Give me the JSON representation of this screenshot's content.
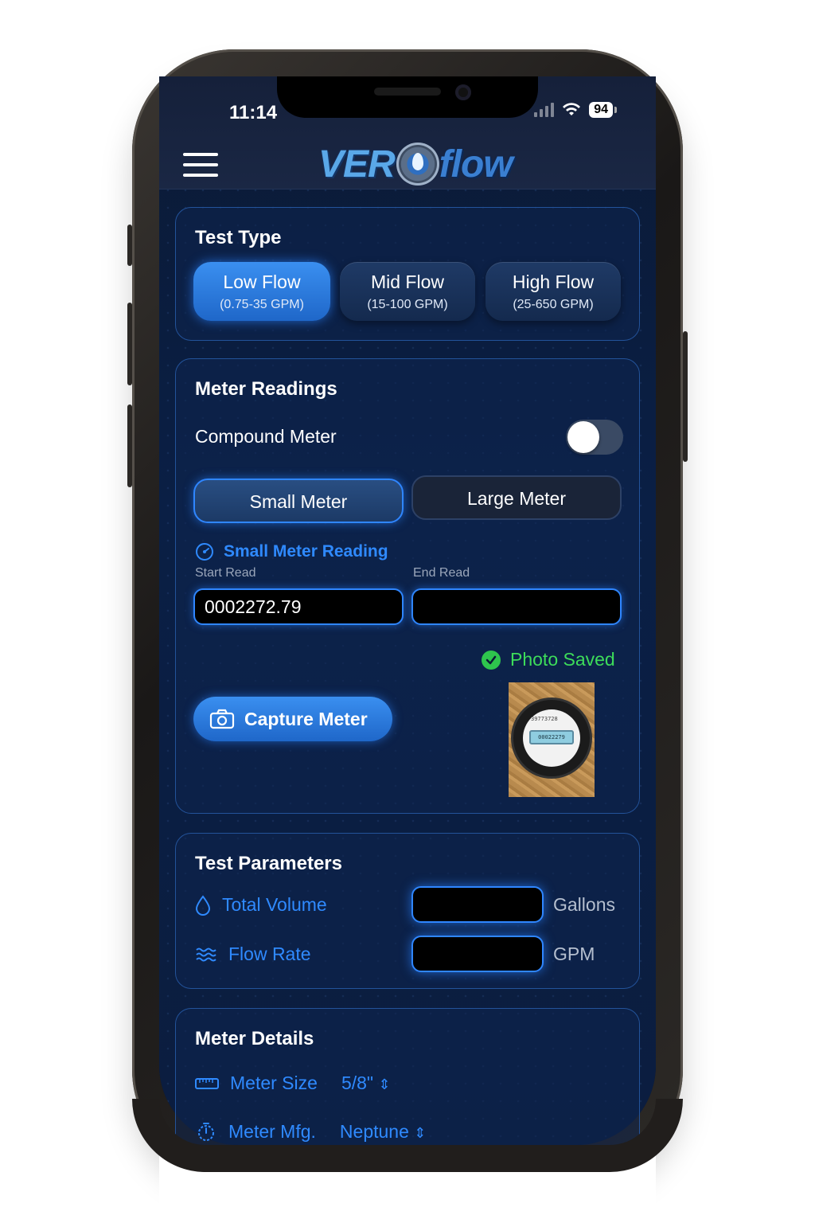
{
  "status_bar": {
    "time": "11:14",
    "battery": "94"
  },
  "header": {
    "logo_left": "VER",
    "logo_right": "flow"
  },
  "test_type": {
    "title": "Test Type",
    "options": [
      {
        "label": "Low Flow",
        "range": "(0.75-35 GPM)",
        "active": true
      },
      {
        "label": "Mid Flow",
        "range": "(15-100 GPM)",
        "active": false
      },
      {
        "label": "High Flow",
        "range": "(25-650 GPM)",
        "active": false
      }
    ]
  },
  "meter_readings": {
    "title": "Meter Readings",
    "compound_label": "Compound Meter",
    "compound_on": false,
    "small_meter_label": "Small Meter",
    "large_meter_label": "Large Meter",
    "reading_title": "Small Meter Reading",
    "start_label": "Start Read",
    "end_label": "End Read",
    "start_value": "0002272.79",
    "end_value": "",
    "photo_saved": "Photo Saved",
    "capture_label": "Capture Meter",
    "photo_serial": "39773728",
    "photo_lcd": "00022279"
  },
  "test_parameters": {
    "title": "Test Parameters",
    "volume_label": "Total Volume",
    "volume_unit": "Gallons",
    "volume_value": "",
    "flow_label": "Flow Rate",
    "flow_unit": "GPM",
    "flow_value": ""
  },
  "meter_details": {
    "title": "Meter Details",
    "size_label": "Meter Size",
    "size_value": "5/8\"",
    "mfg_label": "Meter Mfg.",
    "mfg_value": "Neptune"
  },
  "colors": {
    "accent": "#2f8aff",
    "success": "#3ddc5a",
    "background": "#0b1a36"
  }
}
